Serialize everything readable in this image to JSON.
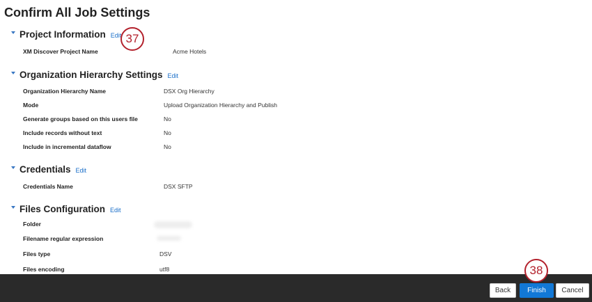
{
  "title": "Confirm All Job Settings",
  "edit_label": "Edit",
  "sections": [
    {
      "heading": "Project Information",
      "rows": [
        {
          "label": "XM Discover Project Name",
          "value": "Acme Hotels"
        }
      ]
    },
    {
      "heading": "Organization Hierarchy Settings",
      "rows": [
        {
          "label": "Organization Hierarchy Name",
          "value": "DSX Org Hierarchy"
        },
        {
          "label": "Mode",
          "value": "Upload Organization Hierarchy and Publish"
        },
        {
          "label": "Generate groups based on this users file",
          "value": "No"
        },
        {
          "label": "Include records without text",
          "value": "No"
        },
        {
          "label": "Include in incremental dataflow",
          "value": "No"
        }
      ]
    },
    {
      "heading": "Credentials",
      "rows": [
        {
          "label": "Credentials Name",
          "value": "DSX SFTP"
        }
      ]
    },
    {
      "heading": "Files Configuration",
      "rows": [
        {
          "label": "Folder",
          "value": ""
        },
        {
          "label": "Filename regular expression",
          "value": ""
        },
        {
          "label": "Files type",
          "value": "DSV"
        },
        {
          "label": "Files encoding",
          "value": "utf8"
        }
      ]
    }
  ],
  "footer": {
    "back": "Back",
    "finish": "Finish",
    "cancel": "Cancel"
  },
  "badges": [
    "37",
    "38"
  ]
}
